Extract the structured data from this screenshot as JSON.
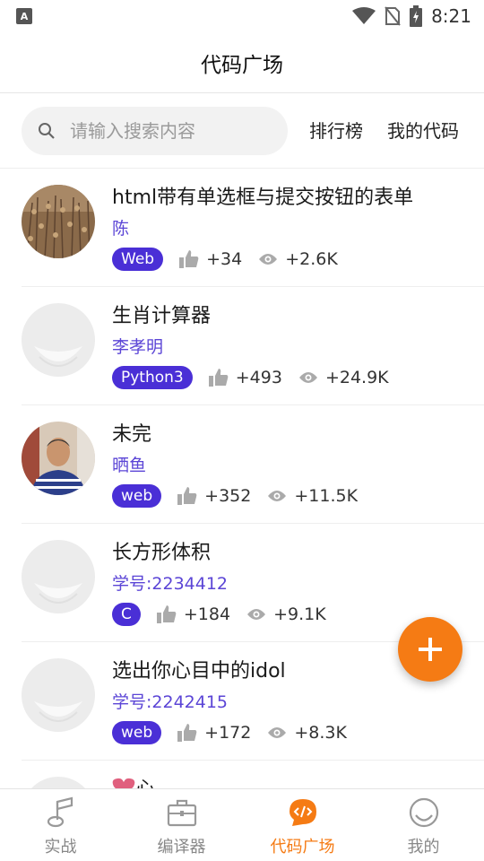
{
  "status_bar": {
    "time": "8:21",
    "left_icon_label": "A"
  },
  "header": {
    "title": "代码广场"
  },
  "search": {
    "placeholder": "请输入搜索内容"
  },
  "top_links": {
    "ranking": "排行榜",
    "my_code": "我的代码"
  },
  "items": [
    {
      "title": "html带有单选框与提交按钮的表单",
      "author": "陈",
      "tag": "Web",
      "likes": "+34",
      "views": "+2.6K",
      "avatar": "photo-field"
    },
    {
      "title": "生肖计算器",
      "author": "李孝明",
      "tag": "Python3",
      "likes": "+493",
      "views": "+24.9K",
      "avatar": "default"
    },
    {
      "title": "未完",
      "author": "晒鱼",
      "tag": "web",
      "likes": "+352",
      "views": "+11.5K",
      "avatar": "photo-person"
    },
    {
      "title": "长方形体积",
      "author": "学号:2234412",
      "tag": "C",
      "likes": "+184",
      "views": "+9.1K",
      "avatar": "default"
    },
    {
      "title": "选出你心目中的idol",
      "author": "学号:2242415",
      "tag": "web",
      "likes": "+172",
      "views": "+8.3K",
      "avatar": "default"
    }
  ],
  "partial_item": {
    "title": "心"
  },
  "fab": {
    "icon": "plus-icon"
  },
  "bottom_nav": [
    {
      "label": "实战",
      "icon": "music-note-icon",
      "active": false
    },
    {
      "label": "编译器",
      "icon": "briefcase-icon",
      "active": false
    },
    {
      "label": "代码广场",
      "icon": "code-bubble-icon",
      "active": true
    },
    {
      "label": "我的",
      "icon": "profile-circle-icon",
      "active": false
    }
  ],
  "colors": {
    "accent": "#f57b14",
    "tag_bg": "#4a2fd6",
    "author": "#5b45d6"
  }
}
